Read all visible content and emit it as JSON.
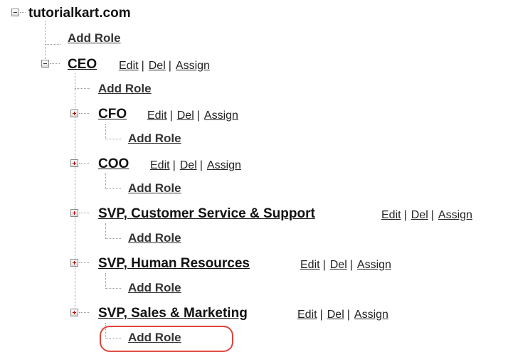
{
  "root": {
    "label": "tutorialkart.com",
    "add_role": "Add Role"
  },
  "ceo": {
    "label": "CEO",
    "edit": "Edit",
    "del": "Del",
    "assign": "Assign",
    "add_role": "Add Role"
  },
  "children": [
    {
      "label": "CFO",
      "edit": "Edit",
      "del": "Del",
      "assign": "Assign",
      "add_role": "Add Role"
    },
    {
      "label": "COO",
      "edit": "Edit",
      "del": "Del",
      "assign": "Assign",
      "add_role": "Add Role"
    },
    {
      "label": "SVP, Customer Service & Support",
      "edit": "Edit",
      "del": "Del",
      "assign": "Assign",
      "add_role": "Add Role"
    },
    {
      "label": "SVP, Human Resources",
      "edit": "Edit",
      "del": "Del",
      "assign": "Assign",
      "add_role": "Add Role"
    },
    {
      "label": "SVP, Sales & Marketing",
      "edit": "Edit",
      "del": "Del",
      "assign": "Assign",
      "add_role": "Add Role"
    }
  ],
  "colors": {
    "highlight": "#e0443a",
    "text": "#111111",
    "expand_icon": "#c00000"
  }
}
